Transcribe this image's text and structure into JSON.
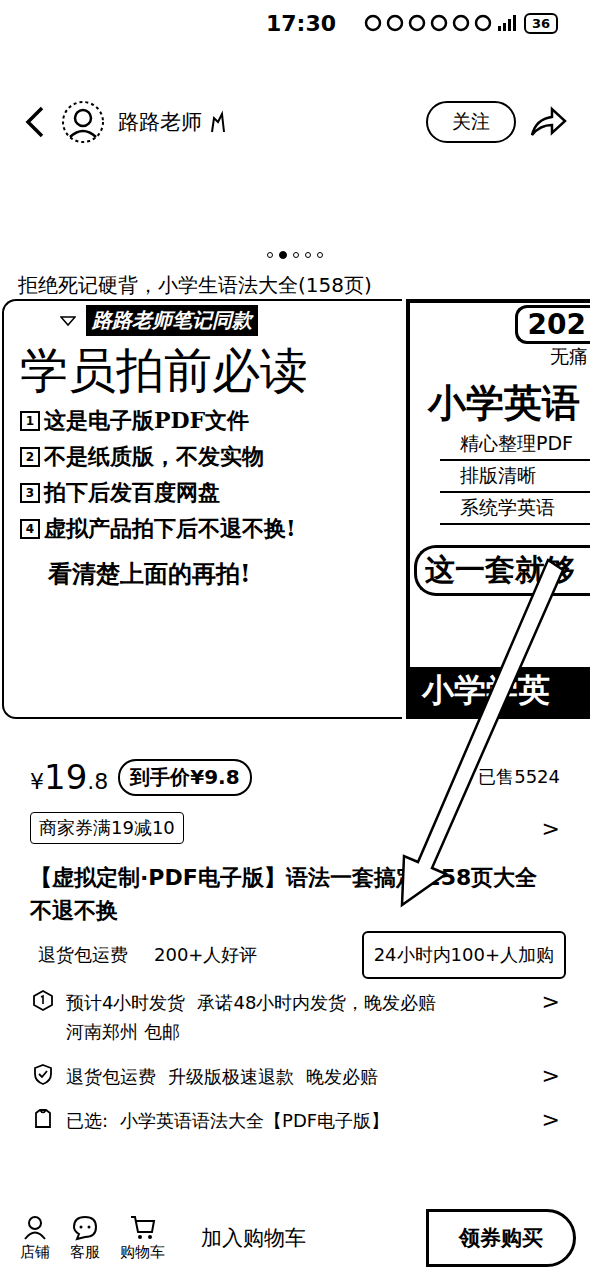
{
  "status_bar": {
    "time": "17:30",
    "battery": "36"
  },
  "header": {
    "shop_name": "路路老师",
    "follow": "关注"
  },
  "carousel": {
    "dots": [
      {
        "selected": false
      },
      {
        "selected": true
      },
      {
        "selected": false
      },
      {
        "selected": false
      },
      {
        "selected": false
      }
    ]
  },
  "product_image": {
    "caption": "拒绝死记硬背，小学生语法大全(158页)",
    "left": {
      "tag": "路路老师笔记同款",
      "title": "学员拍前必读",
      "items": [
        {
          "num": "1",
          "text": "这是电子版PDF文件"
        },
        {
          "num": "2",
          "text": "不是纸质版，不发实物"
        },
        {
          "num": "3",
          "text": "拍下后发百度网盘"
        },
        {
          "num": "4",
          "text": "虚拟产品拍下后不退不换!"
        }
      ],
      "footer": "看清楚上面的再拍!"
    },
    "right": {
      "year": "202",
      "subtitle": "无痛",
      "title": "小学英语",
      "lines": [
        "精心整理PDF",
        "排版清晰",
        "系统学英语"
      ],
      "banner": "这一套就够",
      "bottom": "小学学英"
    }
  },
  "price": {
    "currency": "¥",
    "integer": "19",
    "decimal": ".8",
    "final": "到手价¥9.8",
    "sold": "已售5524"
  },
  "coupon": {
    "label": "商家券满19减10",
    "chevron": ">"
  },
  "title": "【虚拟定制·PDF电子版】语法一套搞定 258页大全 不退不换",
  "tags": [
    {
      "label": "退货包运费",
      "highlighted": false
    },
    {
      "label": "200+人好评",
      "highlighted": false
    },
    {
      "label": "24小时内100+人加购",
      "highlighted": true
    }
  ],
  "info_rows": [
    {
      "kind": "shipping",
      "parts": [
        "预计4小时发货",
        "承诺48小时内发货，晚发必赔"
      ],
      "sub": "河南郑州 包邮",
      "chevron": ">"
    },
    {
      "kind": "guarantee",
      "parts": [
        "退货包运费",
        "升级版极速退款",
        "晚发必赔"
      ],
      "sub": "",
      "chevron": ">"
    },
    {
      "kind": "selected",
      "parts": [
        "已选:",
        "小学英语语法大全【PDF电子版】"
      ],
      "sub": "",
      "chevron": ">"
    }
  ],
  "bottom_bar": {
    "icons": [
      {
        "label": "店铺"
      },
      {
        "label": "客服"
      },
      {
        "label": "购物车"
      }
    ],
    "add_to_cart": "加入购物车",
    "buy": "领券购买"
  }
}
